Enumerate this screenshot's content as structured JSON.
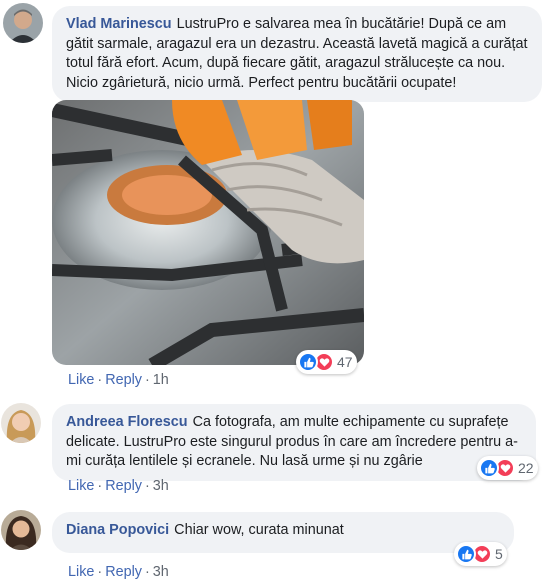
{
  "comments": [
    {
      "author": "Vlad Marinescu",
      "text": "LustruPro e salvarea mea în bucătărie! După ce am gătit sarmale, aragazul era un dezastru. Această lavetă magică a curățat totul fără efort. Acum, după fiecare gătit, aragazul strălucește ca nou. Nicio zgârietură, nicio urmă. Perfect pentru bucătării ocupate!",
      "reaction_count": "47",
      "like_label": "Like",
      "reply_label": "Reply",
      "time": "1h",
      "image": "gas-stove-cleaning-photo"
    },
    {
      "author": "Andreea Florescu",
      "text": "Ca fotografa, am multe echipamente cu suprafețe delicate. LustruPro este singurul produs în care am încredere pentru a-mi curăța lentilele și ecranele. Nu lasă urme și nu zgârie",
      "reaction_count": "22",
      "like_label": "Like",
      "reply_label": "Reply",
      "time": "3h"
    },
    {
      "author": "Diana Popovici",
      "text": "Chiar wow, curata minunat",
      "reaction_count": "5",
      "like_label": "Like",
      "reply_label": "Reply",
      "time": "3h"
    }
  ],
  "colors": {
    "author": "#385898",
    "link": "#4267b2",
    "bubble": "#f0f2f5",
    "like": "#1877f2",
    "love": "#f33e58"
  },
  "icons": [
    "like-icon",
    "love-icon"
  ]
}
